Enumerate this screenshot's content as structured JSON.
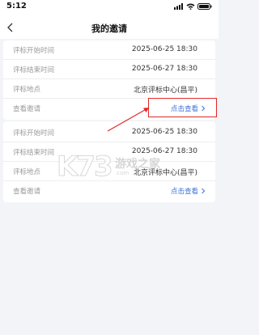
{
  "status_bar": {
    "time": "5:12"
  },
  "nav": {
    "title": "我的邀请"
  },
  "invitations": [
    {
      "start_label": "评标开始时间",
      "start_value": "2025-06-25 18:30",
      "end_label": "评标结束时间",
      "end_value": "2025-06-27 18:30",
      "place_label": "评标地点",
      "place_value": "北京评标中心(昌平)",
      "view_label": "查看邀请",
      "view_link": "点击查看"
    },
    {
      "start_label": "评标开始时间",
      "start_value": "2025-06-25 18:30",
      "end_label": "评标结束时间",
      "end_value": "2025-06-27 18:30",
      "place_label": "评标地点",
      "place_value": "北京评标中心(昌平)",
      "view_label": "查看邀请",
      "view_link": "点击查看"
    }
  ],
  "watermark": {
    "logo": "K73",
    "text": "游戏之家",
    "url": ".com"
  },
  "colors": {
    "link": "#3c73d9",
    "annotation": "#e0292a"
  }
}
